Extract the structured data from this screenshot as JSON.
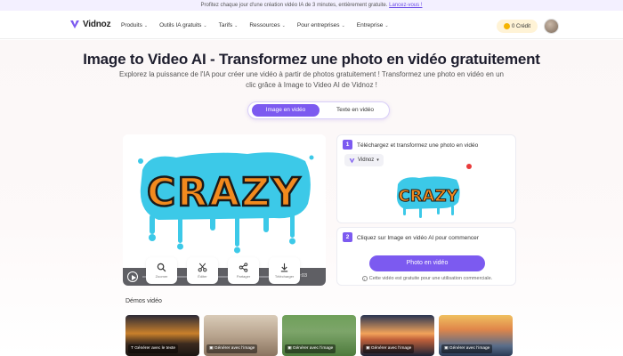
{
  "promo": {
    "text": "Profitez chaque jour d'une création vidéo IA de 3 minutes, entièrement gratuite.",
    "link": "Lancez-vous !"
  },
  "nav": {
    "logo": "Vidnoz",
    "items": [
      {
        "label": "Produits"
      },
      {
        "label": "Outils IA gratuits"
      },
      {
        "label": "Tarifs"
      },
      {
        "label": "Ressources"
      },
      {
        "label": "Pour entreprises"
      },
      {
        "label": "Entreprise"
      }
    ],
    "credit": "0 Crédit"
  },
  "hero": {
    "title": "Image to Video AI - Transformez une photo en vidéo gratuitement",
    "subtitle": "Explorez la puissance de l'IA pour créer une vidéo à partir de photos gratuitement ! Transformez une photo en vidéo en un clic grâce à Image to Video AI de Vidnoz !"
  },
  "toggle": {
    "active": "Image en vidéo",
    "inactive": "Texte en vidéo"
  },
  "player": {
    "art_text": "CRAZY",
    "time": "00:00/00:03",
    "progress": 0
  },
  "tools": [
    {
      "label": "Zoomer",
      "icon": "search-icon"
    },
    {
      "label": "Éditer",
      "icon": "scissors-icon"
    },
    {
      "label": "Partager",
      "icon": "share-icon"
    },
    {
      "label": "Télécharger",
      "icon": "download-icon"
    }
  ],
  "step1": {
    "number": "1",
    "title": "Téléchargez et transformez une photo en vidéo",
    "chip": "Vidnoz"
  },
  "step2": {
    "number": "2",
    "title": "Cliquez sur Image en vidéo AI pour commencer",
    "button": "Photo en vidéo",
    "note": "Cette vidéo est gratuite pour une utilisation commerciale."
  },
  "demos": {
    "title": "Démos vidéo",
    "items": [
      {
        "label": "Générer avec le texte"
      },
      {
        "label": "Générer avec l'image"
      },
      {
        "label": "Générer avec l'image"
      },
      {
        "label": "Générer avec l'image"
      },
      {
        "label": "Générer avec l'image"
      }
    ]
  },
  "colors": {
    "accent": "#7c5af0",
    "graffiti_orange": "#f28a1e",
    "graffiti_drip": "#3cc9e8"
  }
}
